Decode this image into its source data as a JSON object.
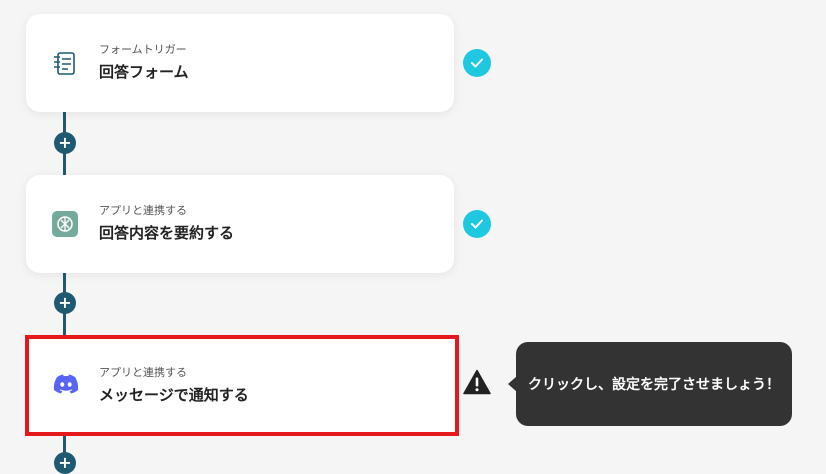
{
  "steps": [
    {
      "subtitle": "フォームトリガー",
      "title": "回答フォーム",
      "icon": "form-icon",
      "status": "complete"
    },
    {
      "subtitle": "アプリと連携する",
      "title": "回答内容を要約する",
      "icon": "chatgpt-icon",
      "status": "complete"
    },
    {
      "subtitle": "アプリと連携する",
      "title": "メッセージで通知する",
      "icon": "discord-icon",
      "status": "warning"
    }
  ],
  "tooltip": {
    "text": "クリックし、設定を完了させましょう！"
  },
  "colors": {
    "connector": "#1e5a72",
    "check": "#1ec8e0",
    "highlight": "#e3191c",
    "discord": "#5865f2",
    "chatgpt": "#74aa9c",
    "tooltip_bg": "#333333"
  }
}
